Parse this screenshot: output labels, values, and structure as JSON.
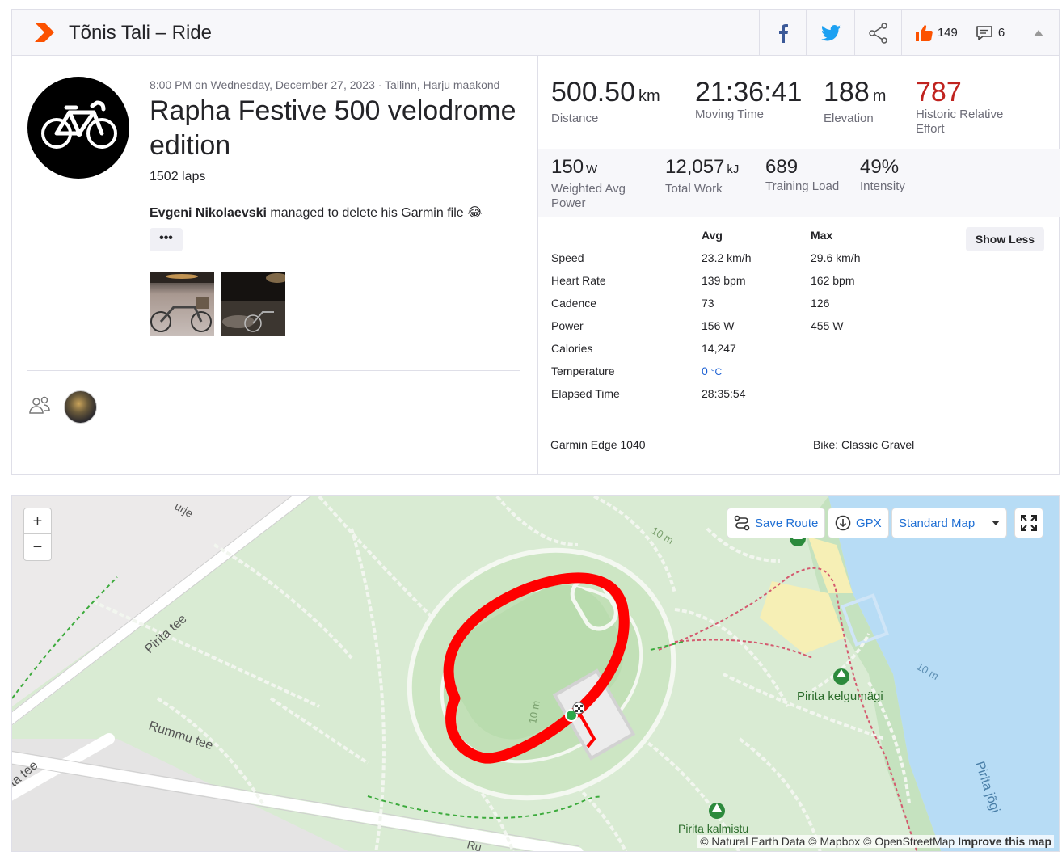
{
  "header": {
    "title": "Tõnis Tali – Ride",
    "kudos_count": "149",
    "comments_count": "6"
  },
  "activity": {
    "date": "8:00 PM on Wednesday, December 27, 2023 · Tallinn, Harju maakond",
    "title": "Rapha Festive 500 velodrome edition",
    "laps": "1502 laps",
    "desc_name": "Evgeni Nikolaevski",
    "desc_rest": " managed to delete his Garmin file 😂",
    "more": "•••"
  },
  "primary": [
    {
      "value": "500.50",
      "unit": "km",
      "label": "Distance"
    },
    {
      "value": "21:36:41",
      "unit": "",
      "label": "Moving Time"
    },
    {
      "value": "188",
      "unit": "m",
      "label": "Elevation"
    },
    {
      "value": "787",
      "unit": "",
      "label": "Historic Relative Effort"
    }
  ],
  "secondary": [
    {
      "value": "150",
      "unit": "W",
      "label": "Weighted Avg Power"
    },
    {
      "value": "12,057",
      "unit": "kJ",
      "label": "Total Work"
    },
    {
      "value": "689",
      "unit": "",
      "label": "Training Load"
    },
    {
      "value": "49%",
      "unit": "",
      "label": "Intensity"
    }
  ],
  "table": {
    "avg_header": "Avg",
    "max_header": "Max",
    "show_less": "Show Less",
    "rows": [
      {
        "label": "Speed",
        "avg": "23.2 km/h",
        "max": "29.6 km/h"
      },
      {
        "label": "Heart Rate",
        "avg": "139 bpm",
        "max": "162 bpm"
      },
      {
        "label": "Cadence",
        "avg": "73",
        "max": "126"
      },
      {
        "label": "Power",
        "avg": "156 W",
        "max": "455 W"
      },
      {
        "label": "Calories",
        "avg": "14,247",
        "max": ""
      },
      {
        "label": "Temperature",
        "avg": "0",
        "avg_unit": "°C",
        "max": ""
      },
      {
        "label": "Elapsed Time",
        "avg": "28:35:54",
        "max": ""
      }
    ]
  },
  "device": "Garmin Edge 1040",
  "bike": "Bike: Classic Gravel",
  "map": {
    "zoom_in": "+",
    "zoom_out": "−",
    "save_route": "Save Route",
    "gpx": "GPX",
    "map_type": "Standard Map",
    "labels": {
      "pirita_tee": "Pirita tee",
      "rummu_tee": "Rummu tee",
      "tee_left": "ta tee",
      "kelgumagi": "Pirita kelgumägi",
      "kalmistu": "Pirita kalmistu",
      "pirita_jogi": "Pirita jõgi",
      "ten_m_a": "10 m",
      "ten_m_b": "10 m",
      "ten_m_c": "10 m",
      "urje": "urje",
      "ru": "Ru"
    },
    "attribution": "© Natural Earth Data © Mapbox © OpenStreetMap",
    "improve": "Improve this map"
  },
  "colors": {
    "brand": "#fc5200",
    "effort": "#c0231f",
    "route": "#ff0000",
    "temp": "#1a5fd3"
  }
}
